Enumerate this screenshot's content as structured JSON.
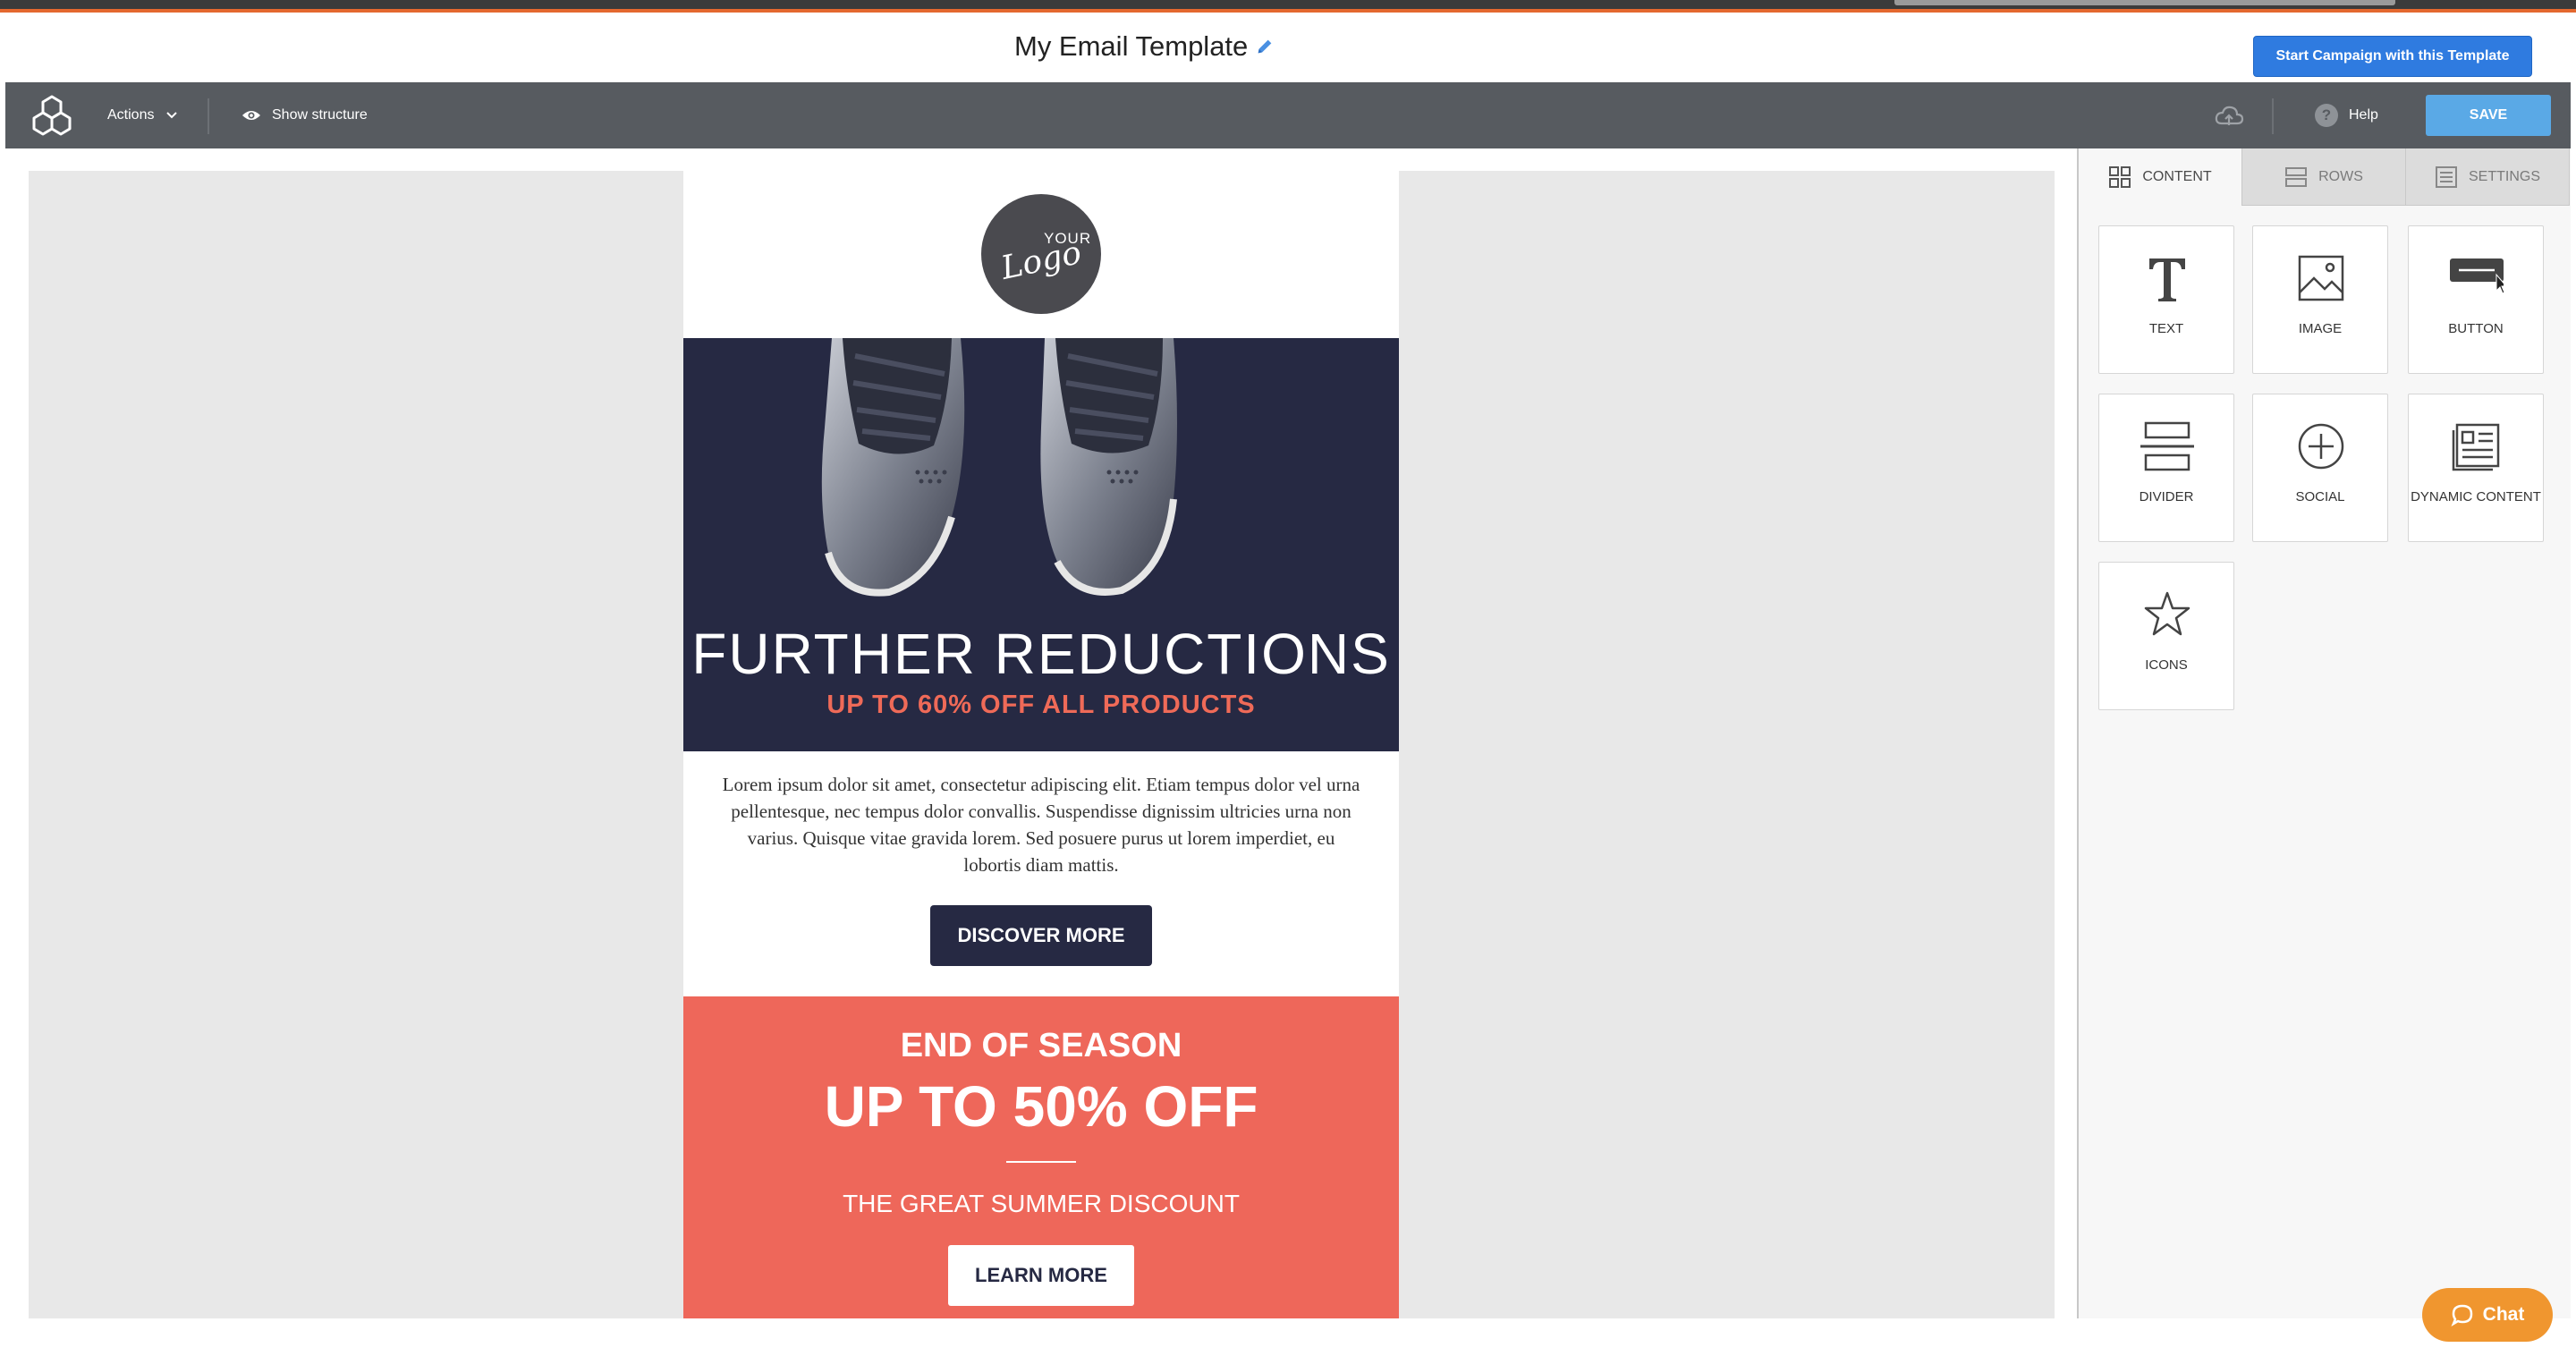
{
  "header": {
    "template_title": "My Email Template",
    "start_campaign_label": "Start Campaign with this Template"
  },
  "toolbar": {
    "actions_label": "Actions",
    "show_structure_label": "Show structure",
    "help_label": "Help",
    "save_label": "SAVE"
  },
  "email": {
    "logo_top": "YOUR",
    "logo_word": "Logo",
    "hero_title": "FURTHER REDUCTIONS",
    "hero_subtitle": "UP TO 60% OFF ALL PRODUCTS",
    "body_text": "Lorem ipsum dolor sit amet, consectetur adipiscing elit. Etiam tempus dolor vel urna pellentesque, nec tempus dolor convallis. Suspendisse dignissim ultricies urna non varius. Quisque vitae gravida lorem. Sed posuere purus ut lorem imperdiet, eu lobortis diam mattis.",
    "discover_label": "DISCOVER MORE",
    "promo_kicker": "END OF SEASON",
    "promo_headline": "UP TO 50% OFF",
    "promo_subline": "THE GREAT SUMMER DISCOUNT",
    "learn_label": "LEARN MORE"
  },
  "sidebar": {
    "tabs": [
      {
        "label": "CONTENT",
        "icon": "grid-icon",
        "active": true
      },
      {
        "label": "ROWS",
        "icon": "rows-icon",
        "active": false
      },
      {
        "label": "SETTINGS",
        "icon": "settings-list-icon",
        "active": false
      }
    ],
    "blocks": [
      {
        "label": "TEXT",
        "icon": "text-icon"
      },
      {
        "label": "IMAGE",
        "icon": "image-icon"
      },
      {
        "label": "BUTTON",
        "icon": "button-icon"
      },
      {
        "label": "DIVIDER",
        "icon": "divider-icon"
      },
      {
        "label": "SOCIAL",
        "icon": "social-icon"
      },
      {
        "label": "DYNAMIC CONTENT",
        "icon": "dynamic-content-icon"
      },
      {
        "label": "ICONS",
        "icon": "star-icon"
      }
    ]
  },
  "chat": {
    "label": "Chat"
  },
  "colors": {
    "toolbar": "#575b60",
    "primary_button": "#2f7be0",
    "save_button": "#5aa9e6",
    "hero_bg": "#262943",
    "accent_red": "#ef6a58",
    "chat": "#f0962f"
  }
}
